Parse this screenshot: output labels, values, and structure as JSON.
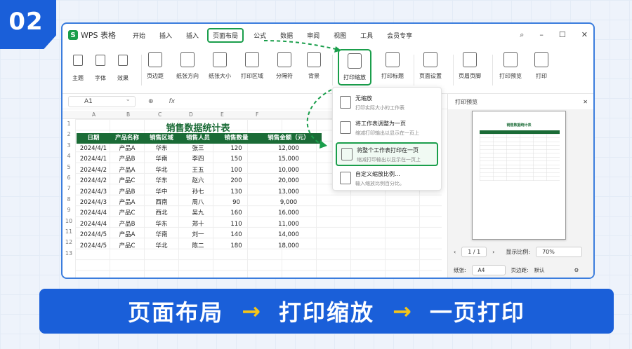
{
  "badge": {
    "step": "02"
  },
  "app": {
    "name": "WPS 表格",
    "logo": "S"
  },
  "menu": [
    "开始",
    "插入",
    "插入",
    "页面布局",
    "公式",
    "数据",
    "审阅",
    "视图",
    "工具",
    "会员专享"
  ],
  "ribbon": {
    "small": [
      "主题",
      "字体",
      "效果"
    ],
    "large": [
      "页边距",
      "纸张方向",
      "纸张大小",
      "打印区域",
      "分隔符",
      "背景",
      "打印缩放",
      "打印标题",
      "页面设置",
      "页眉页脚",
      "打印预览",
      "打印"
    ]
  },
  "formula": {
    "cell_ref": "A1",
    "fx": "fx"
  },
  "columns": [
    "A",
    "B",
    "C",
    "D",
    "E",
    "F"
  ],
  "rows": [
    "1",
    "2",
    "3",
    "4",
    "5",
    "6",
    "7",
    "8",
    "9",
    "10",
    "11",
    "12",
    "13"
  ],
  "table": {
    "title": "销售数据统计表",
    "headers": [
      "日期",
      "产品名称",
      "销售区域",
      "销售人员",
      "销售数量",
      "销售金额（元）"
    ],
    "rows": [
      [
        "2024/4/1",
        "产品A",
        "华东",
        "张三",
        "120",
        "12,000"
      ],
      [
        "2024/4/1",
        "产品B",
        "华南",
        "李四",
        "150",
        "15,000"
      ],
      [
        "2024/4/2",
        "产品A",
        "华北",
        "王五",
        "100",
        "10,000"
      ],
      [
        "2024/4/2",
        "产品C",
        "华东",
        "赵六",
        "200",
        "20,000"
      ],
      [
        "2024/4/3",
        "产品B",
        "华中",
        "孙七",
        "130",
        "13,000"
      ],
      [
        "2024/4/3",
        "产品A",
        "西南",
        "周八",
        "90",
        "9,000"
      ],
      [
        "2024/4/4",
        "产品C",
        "西北",
        "吴九",
        "160",
        "16,000"
      ],
      [
        "2024/4/4",
        "产品B",
        "华东",
        "郑十",
        "110",
        "11,000"
      ],
      [
        "2024/4/5",
        "产品A",
        "华南",
        "刘一",
        "140",
        "14,000"
      ],
      [
        "2024/4/5",
        "产品C",
        "华北",
        "陈二",
        "180",
        "18,000"
      ]
    ]
  },
  "dropdown": [
    {
      "title": "无缩放",
      "desc": "打印实际大小的工作表"
    },
    {
      "title": "将工作表调整为一页",
      "desc": "缩减打印输出以显示在一页上"
    },
    {
      "title": "将整个工作表打印在一页",
      "desc": "缩减打印输出以显示在一页上"
    },
    {
      "title": "自定义缩放比例...",
      "desc": "输入缩放比例百分比。"
    }
  ],
  "preview": {
    "title": "打印预览",
    "paper_title": "销售数据统计表",
    "page": "1 / 1",
    "zoom_label": "显示比例:",
    "zoom": "70%",
    "paper_label": "纸张:",
    "paper": "A4",
    "margin_label": "页边距:",
    "margin": "默认"
  },
  "banner": {
    "step1": "页面布局",
    "arrow": "→",
    "step2": "打印缩放",
    "step3": "一页打印"
  },
  "colors": {
    "accent": "#1a9e4b",
    "brand": "#1a5fd9",
    "table_header": "#1a6b36",
    "arrow": "#f5c518"
  }
}
